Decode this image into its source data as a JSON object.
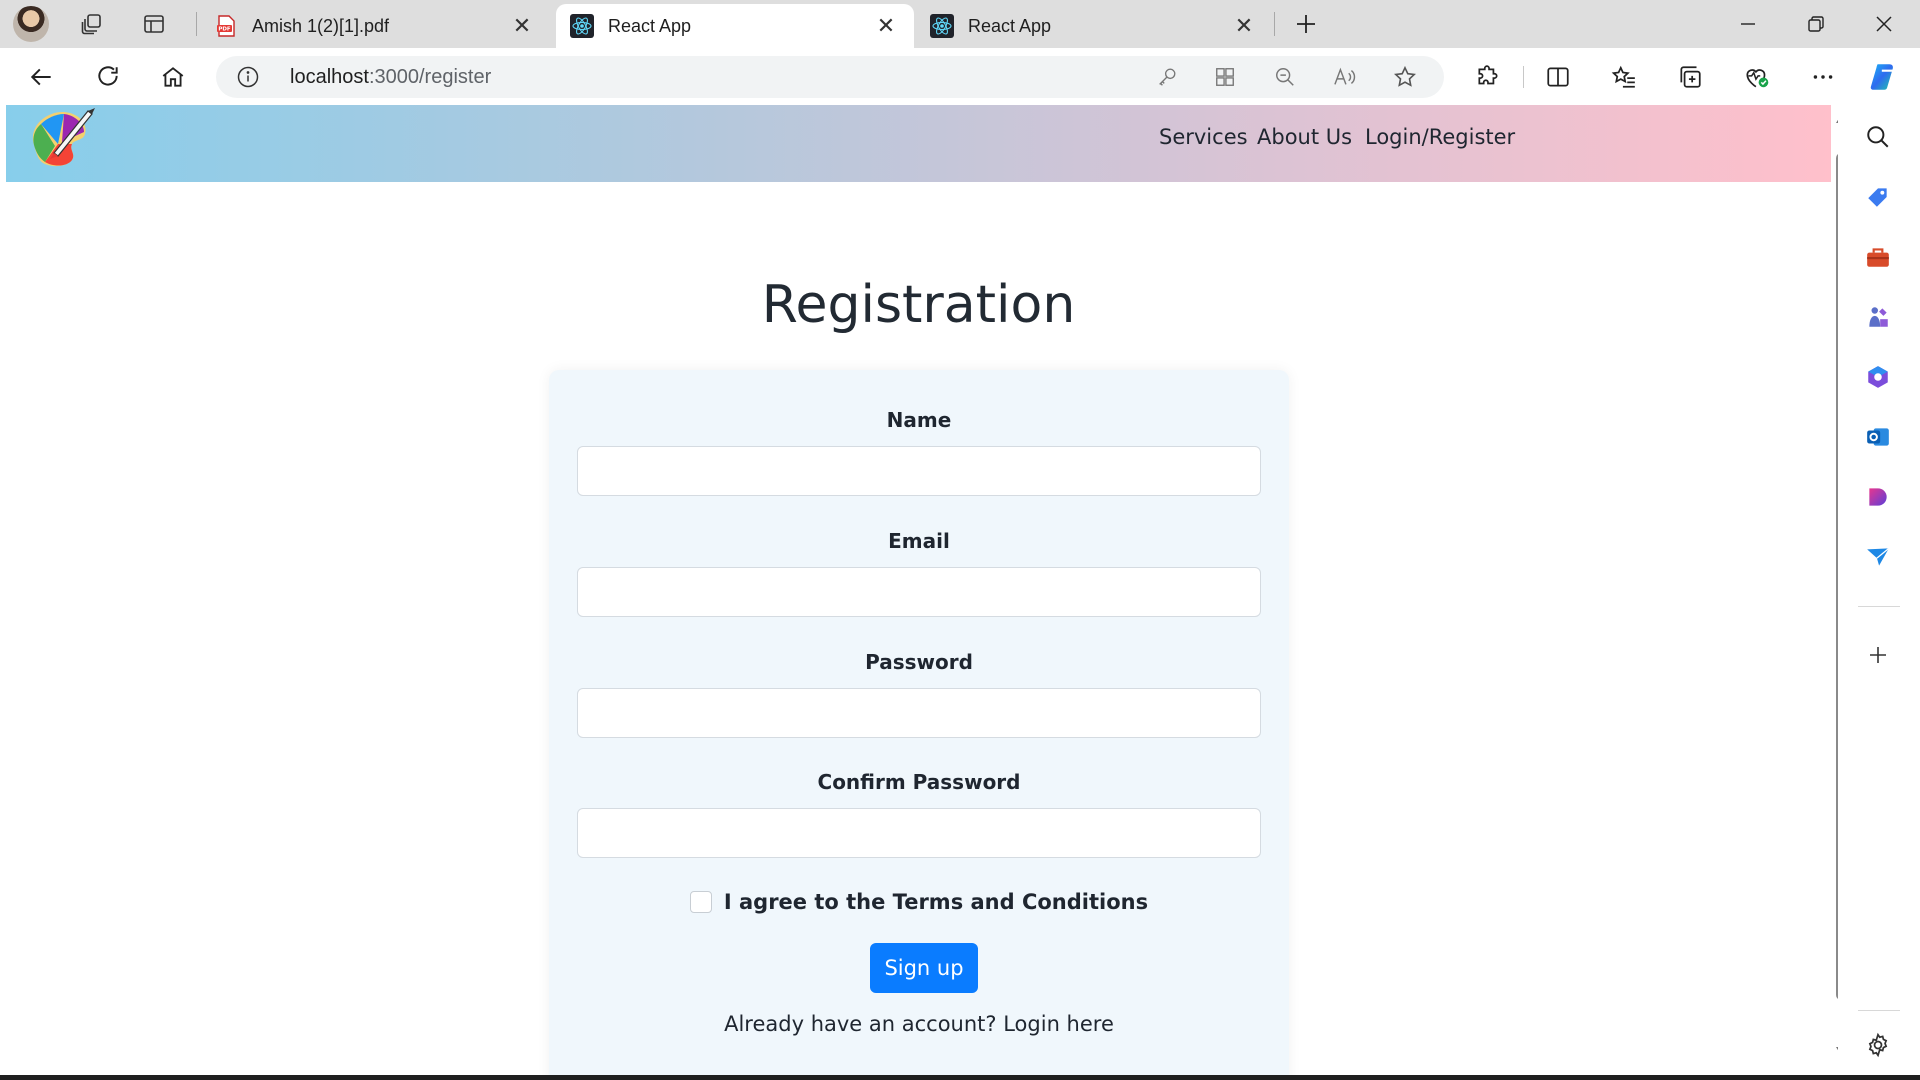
{
  "browser": {
    "tabs": [
      {
        "title": "Amish 1(2)[1].pdf",
        "favicon": "pdf-icon",
        "active": false
      },
      {
        "title": "React App",
        "favicon": "react-icon",
        "active": true
      },
      {
        "title": "React App",
        "favicon": "react-icon",
        "active": false
      }
    ],
    "url_host": "localhost",
    "url_path": ":3000/register"
  },
  "app": {
    "logo": "art-palette-logo",
    "nav": [
      {
        "label": "Services"
      },
      {
        "label": "About Us"
      },
      {
        "label": "Login/Register"
      }
    ]
  },
  "form": {
    "title": "Registration",
    "fields": [
      {
        "label": "Name",
        "value": "",
        "type": "text"
      },
      {
        "label": "Email",
        "value": "",
        "type": "email"
      },
      {
        "label": "Password",
        "value": "",
        "type": "password"
      },
      {
        "label": "Confirm Password",
        "value": "",
        "type": "password"
      }
    ],
    "terms_label": "I agree to the Terms and Conditions",
    "terms_checked": false,
    "submit_label": "Sign up",
    "login_prompt": "Already have an account? Login here"
  },
  "colors": {
    "header_gradient_start": "#87ceeb",
    "header_gradient_end": "#ffc0cb",
    "card_background": "#f0f7fc",
    "primary_button": "#0a7cff"
  }
}
